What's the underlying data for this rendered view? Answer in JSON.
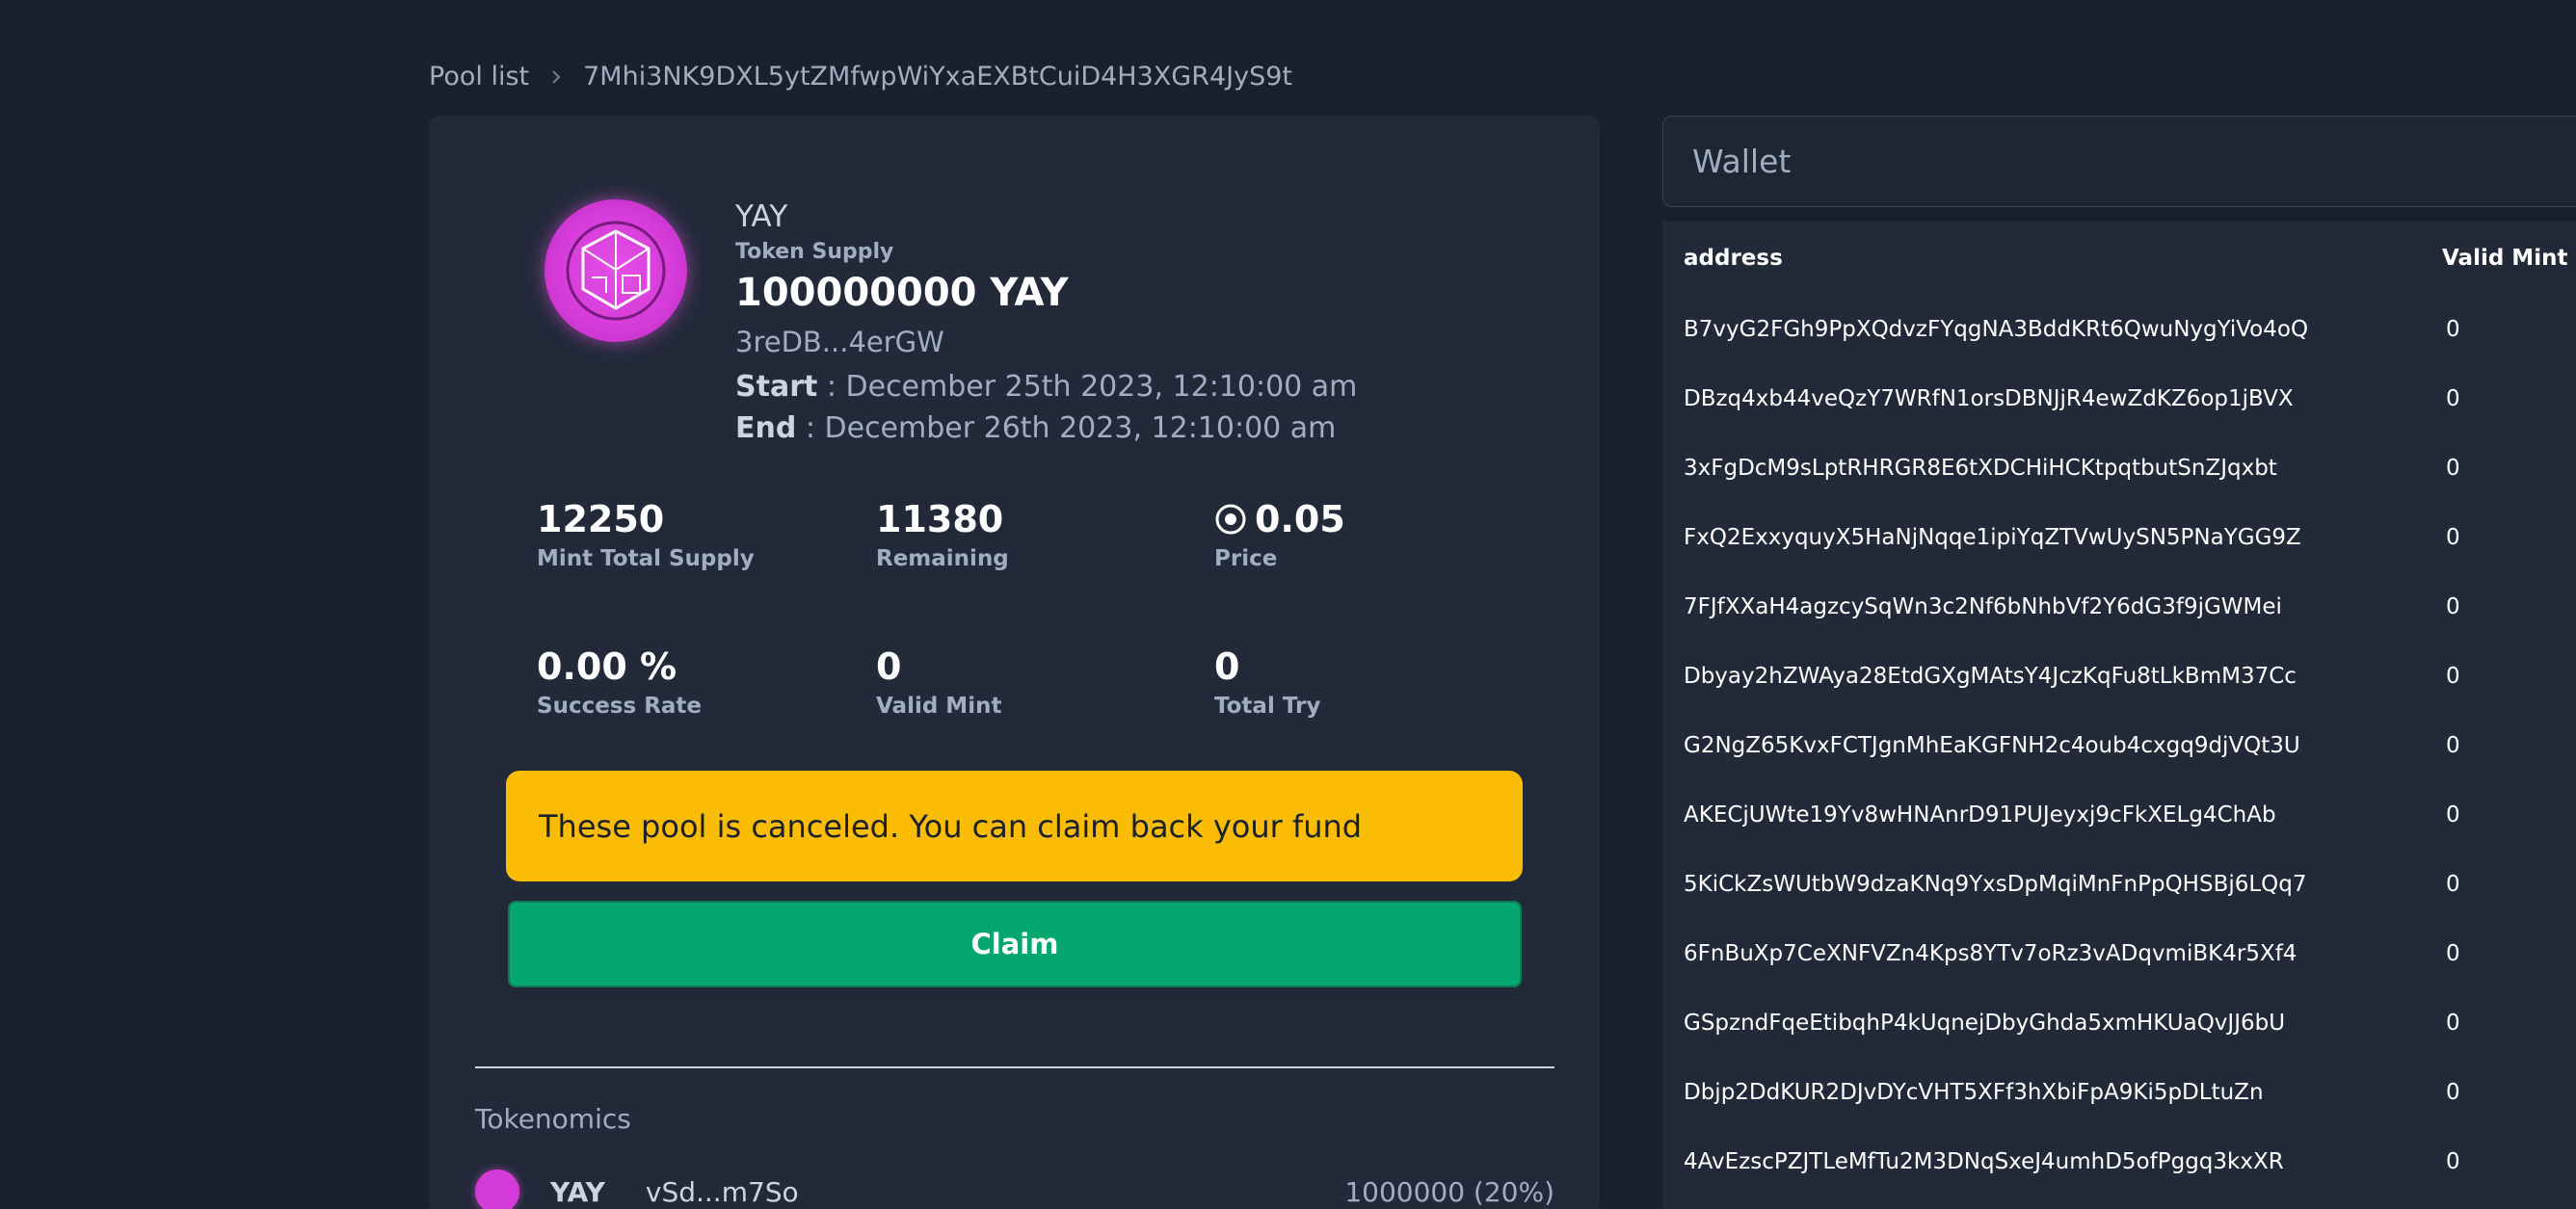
{
  "breadcrumb": {
    "root": "Pool list",
    "current": "7Mhi3NK9DXL5ytZMfwpWiYxaEXBtCuiD4H3XGR4JyS9t"
  },
  "token": {
    "symbol": "YAY",
    "supply_label": "Token Supply",
    "supply_value": "100000000 YAY",
    "address": "3reDB...4erGW",
    "start_label": "Start",
    "start_value": " : December 25th 2023, 12:10:00 am",
    "end_label": "End",
    "end_value": " : December 26th 2023, 12:10:00 am"
  },
  "stats": {
    "mint_total_supply": {
      "value": "12250",
      "label": "Mint Total Supply"
    },
    "remaining": {
      "value": "11380",
      "label": "Remaining"
    },
    "price": {
      "value": "0.05",
      "label": "Price",
      "icon": "solana-circle-icon"
    },
    "success_rate": {
      "value": "0.00 %",
      "label": "Success Rate"
    },
    "valid_mint": {
      "value": "0",
      "label": "Valid Mint"
    },
    "total_try": {
      "value": "0",
      "label": "Total Try"
    }
  },
  "alert": {
    "text": "These pool is canceled. You can claim back your fund",
    "color": "#fbbc05"
  },
  "claim_button": {
    "label": "Claim",
    "color": "#03a66d"
  },
  "tokenomics": {
    "title": "Tokenomics",
    "rows": [
      {
        "symbol": "YAY",
        "address": "vSd...m7So",
        "amount": "1000000 (20%)"
      }
    ]
  },
  "wallet": {
    "placeholder": "Wallet",
    "columns": [
      "address",
      "Valid Mint"
    ],
    "rows": [
      {
        "address": "B7vyG2FGh9PpXQdvzFYqgNA3BddKRt6QwuNygYiVo4oQ",
        "valid_mint": "0"
      },
      {
        "address": "DBzq4xb44veQzY7WRfN1orsDBNJjR4ewZdKZ6op1jBVX",
        "valid_mint": "0"
      },
      {
        "address": "3xFgDcM9sLptRHRGR8E6tXDCHiHCKtpqtbutSnZJqxbt",
        "valid_mint": "0"
      },
      {
        "address": "FxQ2ExxyquyX5HaNjNqqe1ipiYqZTVwUySN5PNaYGG9Z",
        "valid_mint": "0"
      },
      {
        "address": "7FJfXXaH4agzcySqWn3c2Nf6bNhbVf2Y6dG3f9jGWMei",
        "valid_mint": "0"
      },
      {
        "address": "Dbyay2hZWAya28EtdGXgMAtsY4JczKqFu8tLkBmM37Cc",
        "valid_mint": "0"
      },
      {
        "address": "G2NgZ65KvxFCTJgnMhEaKGFNH2c4oub4cxgq9djVQt3U",
        "valid_mint": "0"
      },
      {
        "address": "AKECjUWte19Yv8wHNAnrD91PUJeyxj9cFkXELg4ChAb",
        "valid_mint": "0"
      },
      {
        "address": "5KiCkZsWUtbW9dzaKNq9YxsDpMqiMnFnPpQHSBj6LQq7",
        "valid_mint": "0"
      },
      {
        "address": "6FnBuXp7CeXNFVZn4Kps8YTv7oRz3vADqvmiBK4r5Xf4",
        "valid_mint": "0"
      },
      {
        "address": "GSpzndFqeEtibqhP4kUqnejDbyGhda5xmHKUaQvJJ6bU",
        "valid_mint": "0"
      },
      {
        "address": "Dbjp2DdKUR2DJvDYcVHT5XFf3hXbiFpA9Ki5pDLtuZn",
        "valid_mint": "0"
      },
      {
        "address": "4AvEzscPZJTLeMfTu2M3DNqSxeJ4umhD5ofPggq3kxXR",
        "valid_mint": "0"
      }
    ]
  }
}
